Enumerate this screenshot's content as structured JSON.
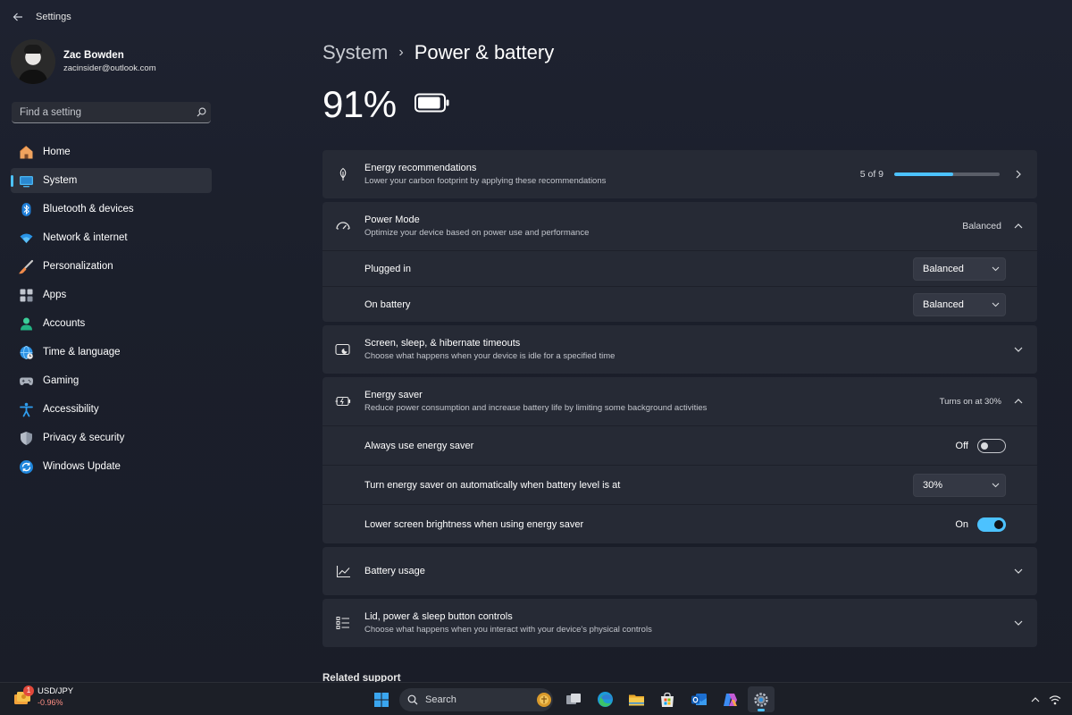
{
  "window": {
    "title": "Settings"
  },
  "profile": {
    "name": "Zac Bowden",
    "email": "zacinsider@outlook.com"
  },
  "search": {
    "placeholder": "Find a setting"
  },
  "sidebar": {
    "items": [
      {
        "label": "Home",
        "icon": "home-icon",
        "active": false
      },
      {
        "label": "System",
        "icon": "system-icon",
        "active": true
      },
      {
        "label": "Bluetooth & devices",
        "icon": "bluetooth-icon",
        "active": false
      },
      {
        "label": "Network & internet",
        "icon": "wifi-icon",
        "active": false
      },
      {
        "label": "Personalization",
        "icon": "brush-icon",
        "active": false
      },
      {
        "label": "Apps",
        "icon": "apps-icon",
        "active": false
      },
      {
        "label": "Accounts",
        "icon": "accounts-icon",
        "active": false
      },
      {
        "label": "Time & language",
        "icon": "globe-clock-icon",
        "active": false
      },
      {
        "label": "Gaming",
        "icon": "gamepad-icon",
        "active": false
      },
      {
        "label": "Accessibility",
        "icon": "accessibility-icon",
        "active": false
      },
      {
        "label": "Privacy & security",
        "icon": "shield-icon",
        "active": false
      },
      {
        "label": "Windows Update",
        "icon": "update-icon",
        "active": false
      }
    ]
  },
  "breadcrumb": {
    "parent": "System",
    "separator": "›",
    "current": "Power & battery"
  },
  "battery": {
    "percent_label": "91%",
    "level": 0.91
  },
  "cards": {
    "energy_recommendations": {
      "title": "Energy recommendations",
      "desc": "Lower your carbon footprint by applying these recommendations",
      "progress_label": "5 of 9",
      "progress": 0.556
    },
    "power_mode": {
      "title": "Power Mode",
      "desc": "Optimize your device based on power use and performance",
      "value": "Balanced",
      "plugged_in": {
        "label": "Plugged in",
        "value": "Balanced"
      },
      "on_battery": {
        "label": "On battery",
        "value": "Balanced"
      }
    },
    "screen_sleep": {
      "title": "Screen, sleep, & hibernate timeouts",
      "desc": "Choose what happens when your device is idle for a specified time"
    },
    "energy_saver": {
      "title": "Energy saver",
      "desc": "Reduce power consumption and increase battery life by limiting some background activities",
      "value": "Turns on at 30%",
      "always": {
        "label": "Always use energy saver",
        "state": "Off"
      },
      "auto": {
        "label": "Turn energy saver on automatically when battery level is at",
        "value": "30%"
      },
      "brightness": {
        "label": "Lower screen brightness when using energy saver",
        "state": "On"
      }
    },
    "battery_usage": {
      "title": "Battery usage"
    },
    "lid_power": {
      "title": "Lid, power & sleep button controls",
      "desc": "Choose what happens when you interact with your device's physical controls"
    }
  },
  "related": {
    "label": "Related support"
  },
  "taskbar": {
    "widget": {
      "title": "USD/JPY",
      "change": "-0.96%",
      "badge": "1"
    },
    "search_label": "Search",
    "apps": [
      "start-icon",
      "task-view-icon",
      "edge-icon",
      "file-explorer-icon",
      "store-icon",
      "outlook-icon",
      "copilot-icon",
      "settings-icon"
    ]
  },
  "colors": {
    "accent": "#4cc2ff",
    "background": "#1b1f2b",
    "card": "#262a35"
  }
}
